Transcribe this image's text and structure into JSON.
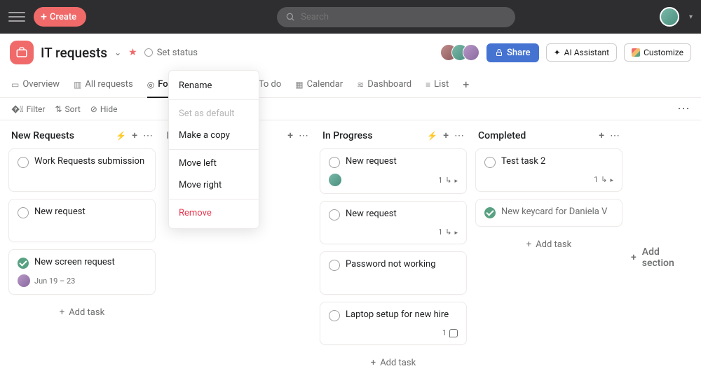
{
  "topbar": {
    "create_label": "Create",
    "search_placeholder": "Search"
  },
  "project": {
    "title": "IT requests",
    "status_label": "Set status",
    "share_label": "Share",
    "ai_label": "AI Assistant",
    "customize_label": "Customize"
  },
  "tabs": [
    {
      "label": "Overview"
    },
    {
      "label": "All requests"
    },
    {
      "label": "Focus today",
      "active": true
    },
    {
      "label": "To do"
    },
    {
      "label": "Calendar"
    },
    {
      "label": "Dashboard"
    },
    {
      "label": "List"
    }
  ],
  "toolbar": {
    "filter": "Filter",
    "sort": "Sort",
    "hide": "Hide"
  },
  "columns": {
    "new_requests": {
      "title": "New Requests",
      "cards": [
        {
          "title": "Work Requests submission"
        },
        {
          "title": "New request"
        },
        {
          "title": "New screen request",
          "done": true,
          "date": "Jun 19 – 23",
          "avatar": true
        }
      ]
    },
    "backlog": {
      "title": "Ba…"
    },
    "in_progress": {
      "title": "In Progress",
      "cards": [
        {
          "title": "New request",
          "avatar": true,
          "subtask_count": "1"
        },
        {
          "title": "New request",
          "subtask_count": "1"
        },
        {
          "title": "Password not working"
        },
        {
          "title": "Laptop setup for new hire",
          "comment_count": "1"
        }
      ]
    },
    "completed": {
      "title": "Completed",
      "cards": [
        {
          "title": "Test task 2",
          "subtask_count": "1"
        },
        {
          "title": "New keycard for Daniela V",
          "done": true
        }
      ]
    }
  },
  "add_task_label": "Add task",
  "add_section_label": "Add section",
  "menu": {
    "rename": "Rename",
    "set_default": "Set as default",
    "copy": "Make a copy",
    "move_left": "Move left",
    "move_right": "Move right",
    "remove": "Remove"
  }
}
